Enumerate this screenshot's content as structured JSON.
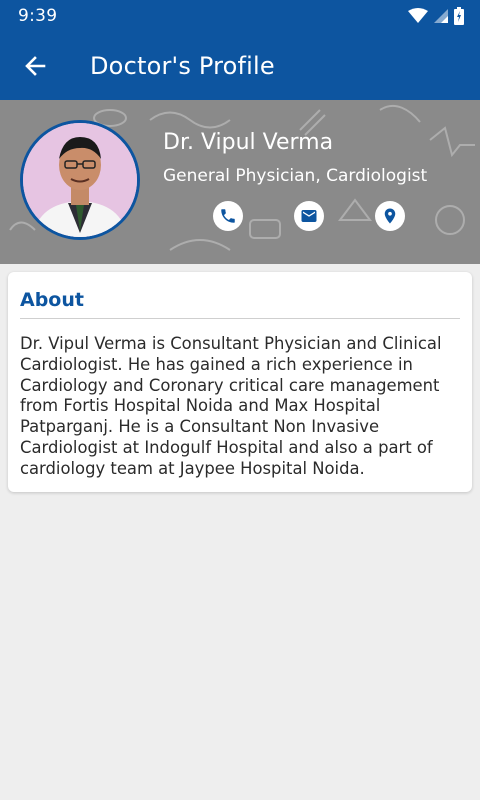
{
  "status_bar": {
    "time": "9:39",
    "icons": [
      "wifi-icon",
      "signal-icon",
      "battery-icon"
    ]
  },
  "app_bar": {
    "title": "Doctor's Profile",
    "back_icon": "arrow-left-icon"
  },
  "doctor": {
    "name": "Dr. Vipul Verma",
    "specialty": "General Physician, Cardiologist",
    "actions": [
      "phone-icon",
      "email-icon",
      "location-icon"
    ]
  },
  "about": {
    "heading": "About",
    "text": "Dr. Vipul Verma is Consultant Physician and Clinical Cardiologist. He has gained a rich experience in Cardiology and Coronary critical care management from Fortis Hospital Noida and Max Hospital Patparganj. He is a Consultant Non Invasive Cardiologist at Indogulf Hospital and also a part of cardiology team at Jaypee Hospital Noida."
  },
  "colors": {
    "primary": "#0d55a0",
    "background": "#eeeeee",
    "banner": "#8a8a8a"
  }
}
